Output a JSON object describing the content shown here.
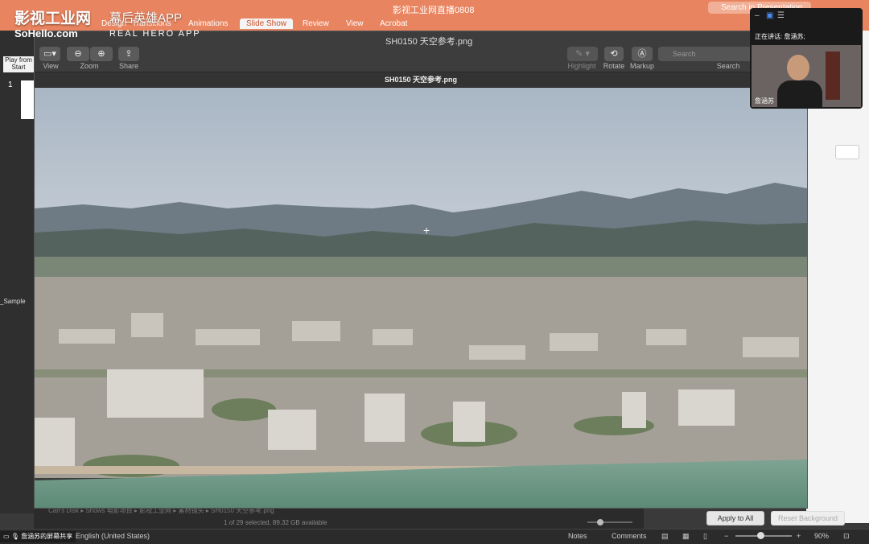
{
  "ppt": {
    "title": "影视工业网直播0808",
    "search_placeholder": "Search in Presentation",
    "tabs": [
      "Design",
      "Transitions",
      "Animations",
      "Slide Show",
      "Review",
      "View",
      "Acrobat"
    ],
    "active_tab": "Slide Show",
    "play_from_start": "Play from Start",
    "slide_number": "1",
    "sample_label": "_Sample",
    "apply_to_all": "Apply to All",
    "reset_background": "Reset Background",
    "language": "English (United States)",
    "notes": "Notes",
    "comments": "Comments",
    "zoom": "90%",
    "share_label": "詹涵苏的屏幕共享"
  },
  "watermark": {
    "brand": "影视工业网",
    "sub": "幕后英雄APP",
    "url": "SoHello.com",
    "en": "REAL HERO APP"
  },
  "finder": {
    "path": "Carl's Disk ▸ Shows 电影项目 ▸ 影视工业网 ▸ 素材镜头 ▸ SH0150 天空参考.png",
    "status": "1 of 29 selected, 89.32 GB available"
  },
  "preview": {
    "filename": "SH0150 天空参考.png",
    "header": "SH0150 天空参考.png",
    "view_label": "View",
    "zoom_label": "Zoom",
    "share_label": "Share",
    "highlight_label": "Highlight",
    "rotate_label": "Rotate",
    "markup_label": "Markup",
    "search_label": "Search",
    "search_placeholder": "Search"
  },
  "call": {
    "speaking": "正在讲话: 詹涵苏;",
    "name": "詹涵苏"
  },
  "colors": {
    "ppt_accent": "#e8845f",
    "sky": "#b7c3cf",
    "sea": "#7fa38f"
  }
}
